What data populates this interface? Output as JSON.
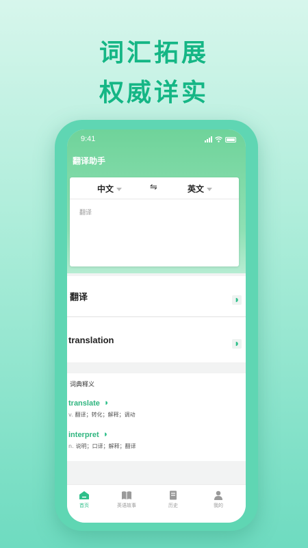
{
  "promo": {
    "line1": "词汇拓展",
    "line2": "权威详实"
  },
  "status": {
    "time": "9:41"
  },
  "app": {
    "title": "翻译助手"
  },
  "translator": {
    "source_lang": "中文",
    "swap_icon": "swap-icon",
    "target_lang": "英文",
    "input_placeholder": "翻译"
  },
  "result": {
    "source_text": "翻译",
    "translated_text": "translation"
  },
  "dictionary": {
    "title": "词典释义",
    "entries": [
      {
        "word": "translate",
        "pos": "v.",
        "definition": "翻译；转化；解释；调动"
      },
      {
        "word": "interpret",
        "pos": "n.",
        "definition": "说明；口译；解释；翻译"
      }
    ]
  },
  "tabs": [
    {
      "label": "首页",
      "icon": "home-icon",
      "active": true
    },
    {
      "label": "英语故事",
      "icon": "book-icon",
      "active": false
    },
    {
      "label": "历史",
      "icon": "document-icon",
      "active": false
    },
    {
      "label": "我的",
      "icon": "person-icon",
      "active": false
    }
  ],
  "colors": {
    "accent": "#2fbf8a",
    "promo": "#15b685",
    "header": "#6fd39a"
  }
}
